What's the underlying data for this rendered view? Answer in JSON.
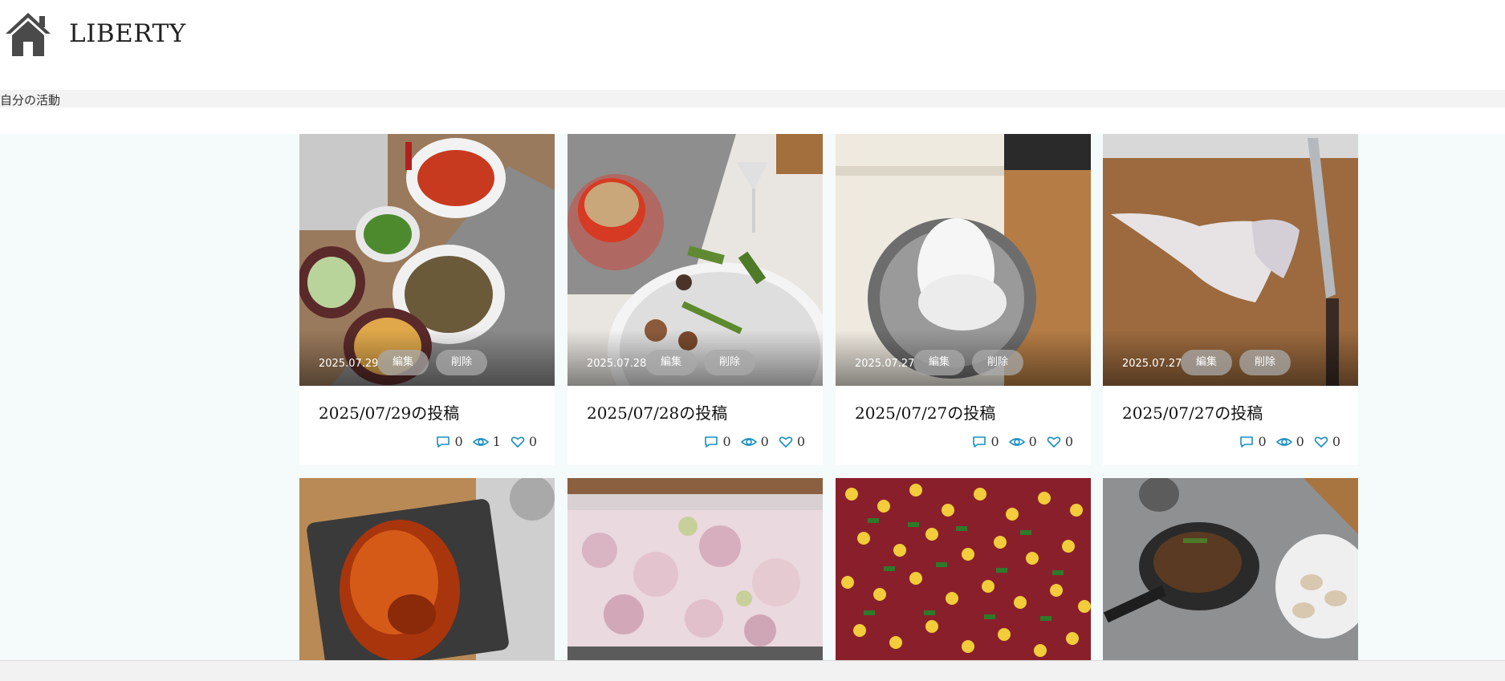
{
  "site": {
    "title": "LIBERTY"
  },
  "activity": {
    "label": "自分の活動"
  },
  "actions": {
    "edit_label": "編集",
    "delete_label": "削除"
  },
  "colors": {
    "accent": "#1a8fc2",
    "content_bg": "#f5fafa"
  },
  "posts": [
    {
      "date": "2025.07.29",
      "title": "2025/07/29の投稿",
      "comments": "0",
      "views": "1",
      "likes": "0"
    },
    {
      "date": "2025.07.28",
      "title": "2025/07/28の投稿",
      "comments": "0",
      "views": "0",
      "likes": "0"
    },
    {
      "date": "2025.07.27",
      "title": "2025/07/27の投稿",
      "comments": "0",
      "views": "0",
      "likes": "0"
    },
    {
      "date": "2025.07.27",
      "title": "2025/07/27の投稿",
      "comments": "0",
      "views": "0",
      "likes": "0"
    },
    {
      "date": "",
      "title": "",
      "comments": "",
      "views": "",
      "likes": ""
    },
    {
      "date": "",
      "title": "",
      "comments": "",
      "views": "",
      "likes": ""
    },
    {
      "date": "",
      "title": "",
      "comments": "",
      "views": "",
      "likes": ""
    },
    {
      "date": "",
      "title": "",
      "comments": "",
      "views": "",
      "likes": ""
    }
  ]
}
